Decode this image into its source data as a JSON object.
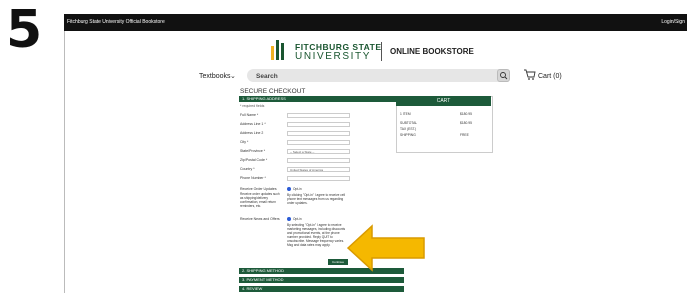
{
  "step_number": "5",
  "topbar": {
    "left": "Fitchburg State University Official Bookstore",
    "right": "Login/Sign"
  },
  "brand": {
    "line1": "FITCHBURG STATE",
    "line2": "UNIVERSITY",
    "line3": "ONLINE BOOKSTORE"
  },
  "nav": {
    "textbooks": "Textbooks",
    "search_placeholder": "Search",
    "cart": "Cart (0)"
  },
  "checkout": {
    "title": "SECURE CHECKOUT",
    "section1": "1. SHIPPING ADDRESS",
    "required": "* required fields",
    "fields": [
      {
        "label": "Full Name *",
        "value": ""
      },
      {
        "label": "Address Line 1 *",
        "value": ""
      },
      {
        "label": "Address Line 2",
        "value": ""
      },
      {
        "label": "City *",
        "value": ""
      },
      {
        "label": "State/Province *",
        "value": "-- Select a State --"
      },
      {
        "label": "Zip/Postal Code *",
        "value": ""
      },
      {
        "label": "Country *",
        "value": "United States of America"
      },
      {
        "label": "Phone Number *",
        "value": ""
      }
    ],
    "order_updates": {
      "label": "Receive Order Updates",
      "sublabel": "Receive order updates such as shipping/delivery confirmation, email return reminders, etc.",
      "option": "Opt-in",
      "text": "By clicking \"Opt-in\" I agree to receive cell phone text messages from us regarding order updates."
    },
    "news_offers": {
      "label": "Receive News and Offers",
      "option": "Opt-in",
      "text": "By selecting \"Opt-in\" I agree to receive marketing messages, including discounts and promotional events, at the phone number provided. Reply QUIT to unsubscribe. Message frequency varies. Msg and data rates may apply."
    },
    "continue": "Continue",
    "section2": "2. SHIPPING METHOD",
    "section3": "3. PAYMENT METHOD",
    "section4": "4. REVIEW"
  },
  "cart": {
    "title": "CART",
    "rows": [
      {
        "label": "1 ITEM",
        "value": "$180.95"
      },
      {
        "label": "SUBTOTAL",
        "value": "$180.95"
      },
      {
        "label": "TAX (EST.)",
        "value": ""
      },
      {
        "label": "SHIPPING",
        "value": "FREE"
      }
    ]
  },
  "colors": {
    "brand_green": "#1d5a3a",
    "arrow": "#f5b800",
    "topbar": "#111111"
  },
  "icons": {
    "search": "search-icon",
    "cart": "cart-icon",
    "chevron": "chevron-down-icon"
  }
}
